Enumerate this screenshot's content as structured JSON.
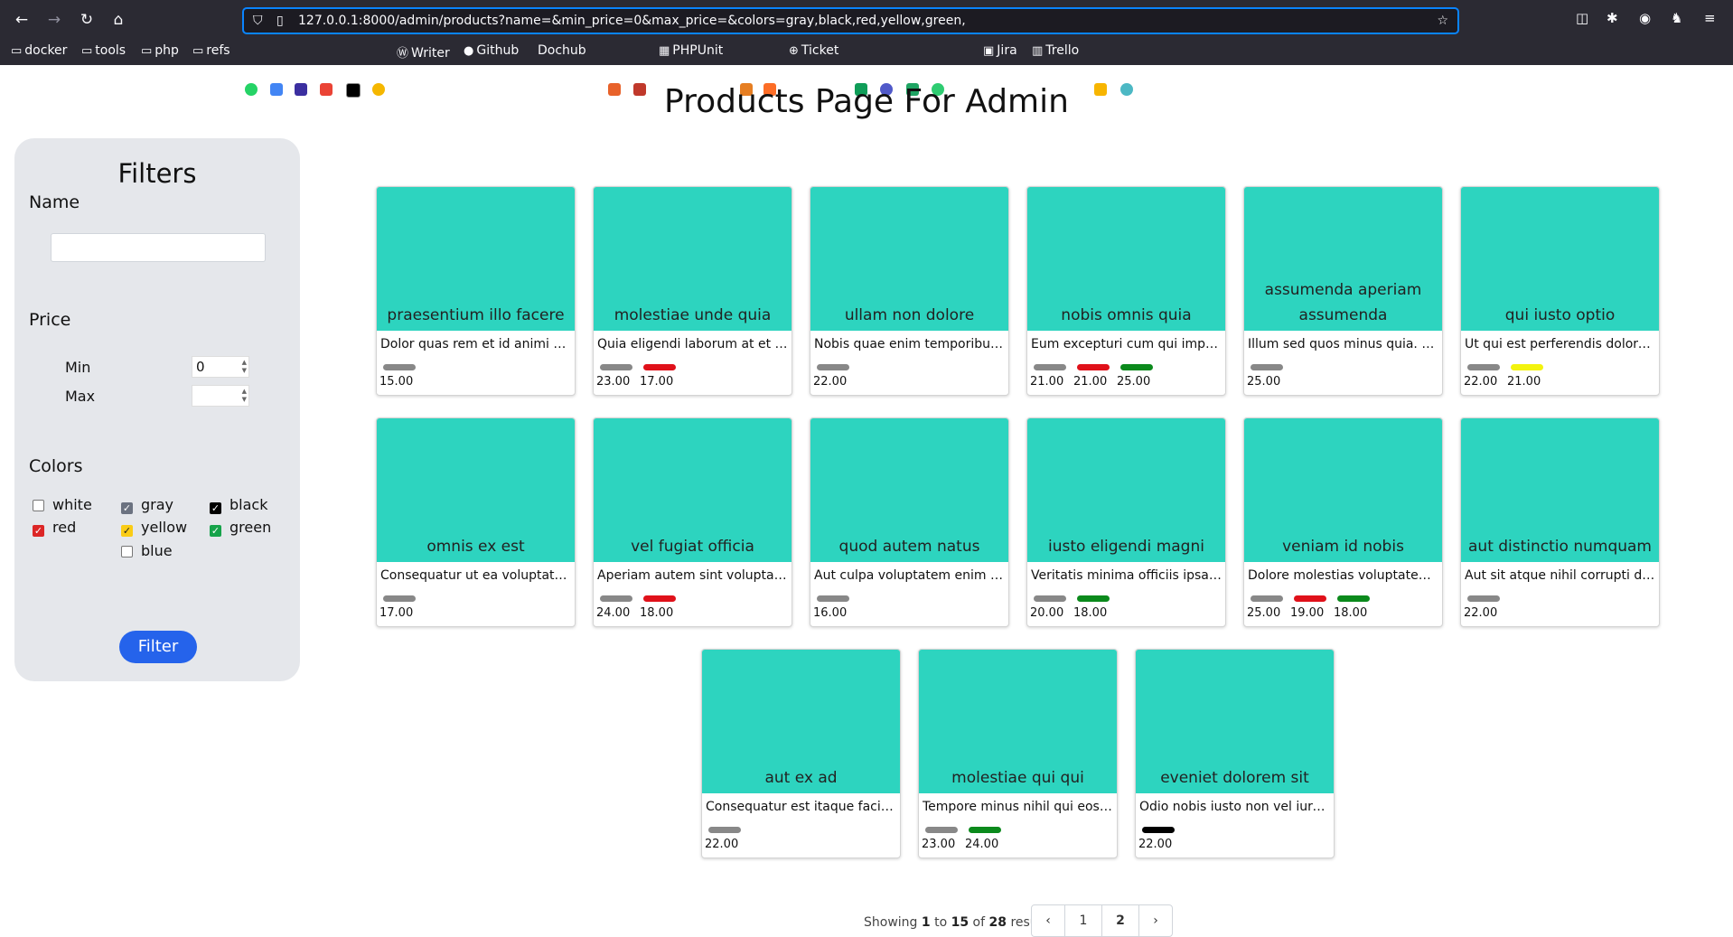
{
  "browser": {
    "url": "127.0.0.1:8000/admin/products?name=&min_price=0&max_price=&colors=gray,black,red,yellow,green,",
    "bookmarks": [
      "docker",
      "tools",
      "php",
      "refs",
      "Writer",
      "Github",
      "Dochub",
      "PHPUnit",
      "Ticket",
      "Jira",
      "Trello"
    ]
  },
  "page": {
    "title": "Products Page For Admin"
  },
  "filters": {
    "heading": "Filters",
    "name_label": "Name",
    "name_value": "",
    "price_label": "Price",
    "min_label": "Min",
    "min_value": "0",
    "max_label": "Max",
    "max_value": "",
    "colors_label": "Colors",
    "colors": [
      {
        "name": "white",
        "checked": false,
        "color": "#ffffff"
      },
      {
        "name": "gray",
        "checked": true,
        "color": "#6b7280"
      },
      {
        "name": "black",
        "checked": true,
        "color": "#000000"
      },
      {
        "name": "red",
        "checked": true,
        "color": "#dc2626"
      },
      {
        "name": "yellow",
        "checked": true,
        "color": "#facc15"
      },
      {
        "name": "green",
        "checked": true,
        "color": "#16a34a"
      },
      {
        "name": "blue",
        "checked": false,
        "color": "#2563eb"
      }
    ],
    "button_label": "Filter"
  },
  "swatch_colors": {
    "gray": "#888888",
    "red": "#e0111a",
    "green": "#0b8a1c",
    "yellow": "#f3f30e",
    "black": "#000000"
  },
  "products": [
    {
      "name": "praesentium illo facere",
      "desc": "Dolor quas rem et id animi mollitia aut.",
      "variants": [
        {
          "color": "gray",
          "price": "15.00"
        }
      ]
    },
    {
      "name": "molestiae unde quia",
      "desc": "Quia eligendi laborum at et repellat.",
      "variants": [
        {
          "color": "gray",
          "price": "23.00"
        },
        {
          "color": "red",
          "price": "17.00"
        }
      ]
    },
    {
      "name": "ullam non dolore",
      "desc": "Nobis quae enim temporibus rerum sed.",
      "variants": [
        {
          "color": "gray",
          "price": "22.00"
        }
      ]
    },
    {
      "name": "nobis omnis quia",
      "desc": "Eum excepturi cum qui impedit dolores.",
      "variants": [
        {
          "color": "gray",
          "price": "21.00"
        },
        {
          "color": "red",
          "price": "21.00"
        },
        {
          "color": "green",
          "price": "25.00"
        }
      ]
    },
    {
      "name": "assumenda aperiam assumenda",
      "desc": "Illum sed quos minus quia. Voluptas.",
      "variants": [
        {
          "color": "gray",
          "price": "25.00"
        }
      ]
    },
    {
      "name": "qui iusto optio",
      "desc": "Ut qui est perferendis dolorem eos.",
      "variants": [
        {
          "color": "gray",
          "price": "22.00"
        },
        {
          "color": "yellow",
          "price": "21.00"
        }
      ]
    },
    {
      "name": "omnis ex est",
      "desc": "Consequatur ut ea voluptates facilis.",
      "variants": [
        {
          "color": "gray",
          "price": "17.00"
        }
      ]
    },
    {
      "name": "vel fugiat officia",
      "desc": "Aperiam autem sint voluptates quia.",
      "variants": [
        {
          "color": "gray",
          "price": "24.00"
        },
        {
          "color": "red",
          "price": "18.00"
        }
      ]
    },
    {
      "name": "quod autem natus",
      "desc": "Aut culpa voluptatem enim dicta est.",
      "variants": [
        {
          "color": "gray",
          "price": "16.00"
        }
      ]
    },
    {
      "name": "iusto eligendi magni",
      "desc": "Veritatis minima officiis ipsa praesentium.",
      "variants": [
        {
          "color": "gray",
          "price": "20.00"
        },
        {
          "color": "green",
          "price": "18.00"
        }
      ]
    },
    {
      "name": "veniam id nobis",
      "desc": "Dolore molestias voluptatem enim ut.",
      "variants": [
        {
          "color": "gray",
          "price": "25.00"
        },
        {
          "color": "red",
          "price": "19.00"
        },
        {
          "color": "green",
          "price": "18.00"
        }
      ]
    },
    {
      "name": "aut distinctio numquam",
      "desc": "Aut sit atque nihil corrupti dolores.",
      "variants": [
        {
          "color": "gray",
          "price": "22.00"
        }
      ]
    },
    {
      "name": "aut ex ad",
      "desc": "Consequatur est itaque facilis sit.",
      "variants": [
        {
          "color": "gray",
          "price": "22.00"
        }
      ]
    },
    {
      "name": "molestiae qui qui",
      "desc": "Tempore minus nihil qui eos porro.",
      "variants": [
        {
          "color": "gray",
          "price": "23.00"
        },
        {
          "color": "green",
          "price": "24.00"
        }
      ]
    },
    {
      "name": "eveniet dolorem sit",
      "desc": "Odio nobis iusto non vel iure vel.",
      "variants": [
        {
          "color": "black",
          "price": "22.00"
        }
      ]
    }
  ],
  "pagination": {
    "showing_prefix": "Showing",
    "from": "1",
    "to_word": "to",
    "to": "15",
    "of_word": "of",
    "total": "28",
    "results_word": "results",
    "prev": "‹",
    "next": "›",
    "pages": [
      "1",
      "2"
    ],
    "current": "2"
  }
}
